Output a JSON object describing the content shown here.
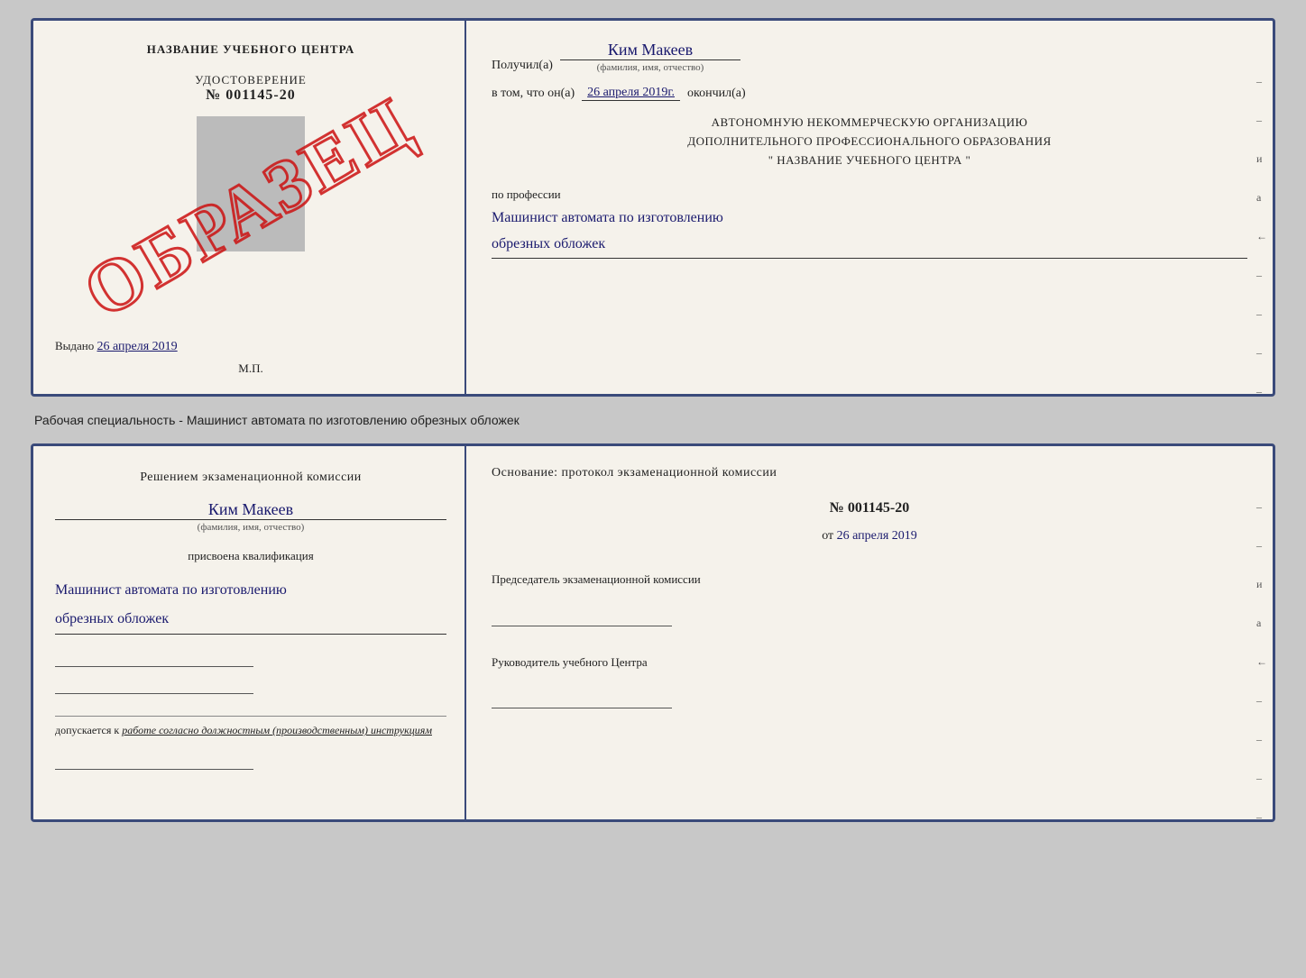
{
  "top_cert": {
    "left": {
      "center_title": "НАЗВАНИЕ УЧЕБНОГО ЦЕНТРА",
      "udostoverenie_label": "УДОСТОВЕРЕНИЕ",
      "number": "№ 001145-20",
      "watermark": "ОБРАЗЕЦ",
      "issued_prefix": "Выдано",
      "issued_date": "26 апреля 2019",
      "mp_label": "М.П."
    },
    "right": {
      "received_prefix": "Получил(а)",
      "recipient_name": "Ким Макеев",
      "fio_sublabel": "(фамилия, имя, отчество)",
      "date_prefix": "в том, что он(а)",
      "date_value": "26 апреля 2019г.",
      "date_suffix": "окончил(а)",
      "org_line1": "АВТОНОМНУЮ НЕКОММЕРЧЕСКУЮ ОРГАНИЗАЦИЮ",
      "org_line2": "ДОПОЛНИТЕЛЬНОГО ПРОФЕССИОНАЛЬНОГО ОБРАЗОВАНИЯ",
      "org_line3": "\" НАЗВАНИЕ УЧЕБНОГО ЦЕНТРА \"",
      "profession_label": "по профессии",
      "profession_line1": "Машинист автомата по изготовлению",
      "profession_line2": "обрезных обложек",
      "side_marks": [
        "и",
        "а",
        "←",
        "–",
        "–",
        "–",
        "–"
      ]
    }
  },
  "caption": {
    "text": "Рабочая специальность - Машинист автомата по изготовлению обрезных обложек"
  },
  "bottom_cert": {
    "left": {
      "decision_text": "Решением экзаменационной комиссии",
      "person_name": "Ким Макеев",
      "fio_sublabel": "(фамилия, имя, отчество)",
      "qualification_label": "присвоена квалификация",
      "qualification_line1": "Машинист автомата по изготовлению",
      "qualification_line2": "обрезных обложек",
      "allowed_label": "допускается к",
      "allowed_text": "работе согласно должностным (производственным) инструкциям"
    },
    "right": {
      "osnov_title": "Основание: протокол экзаменационной комиссии",
      "protocol_number": "№ 001145-20",
      "date_prefix": "от",
      "date_value": "26 апреля 2019",
      "chairman_label": "Председатель экзаменационной комиссии",
      "director_label": "Руководитель учебного Центра",
      "side_marks": [
        "и",
        "а",
        "←",
        "–",
        "–",
        "–",
        "–"
      ]
    }
  }
}
